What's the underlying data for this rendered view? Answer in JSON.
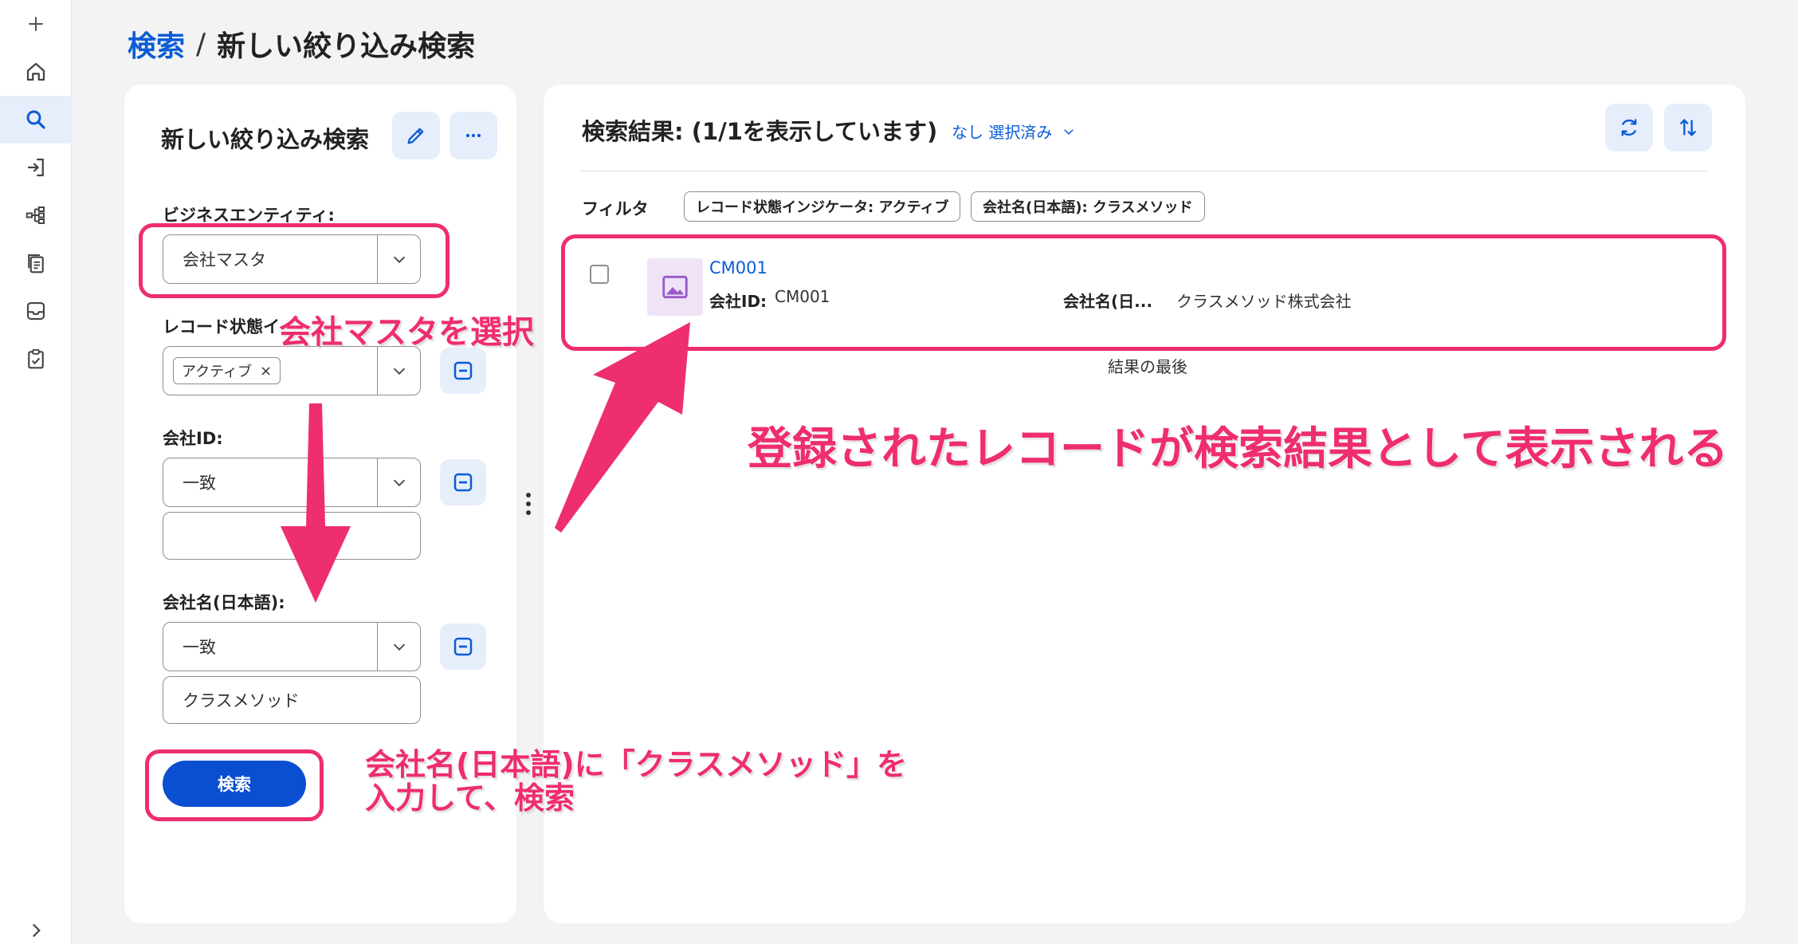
{
  "breadcrumb": {
    "root": "検索",
    "separator": "/",
    "current": "新しい絞り込み検索"
  },
  "rail": {
    "items": [
      "plus-icon",
      "home-icon",
      "search-icon",
      "login-icon",
      "hierarchy-icon",
      "documents-icon",
      "inbox-icon",
      "clipboard-check-icon"
    ],
    "active": "search-icon",
    "footer_icon": "chevron-right-icon"
  },
  "left_panel": {
    "title": "新しい絞り込み検索",
    "business_entity": {
      "label": "ビジネスエンティティ:",
      "value": "会社マスタ"
    },
    "record_status": {
      "label": "レコード状態インジケータ:",
      "chip": "アクティブ",
      "chip_remove": "×"
    },
    "company_id": {
      "label": "会社ID:",
      "operator": "一致",
      "value": ""
    },
    "company_name": {
      "label": "会社名(日本語):",
      "operator": "一致",
      "value": "クラスメソッド"
    },
    "search_button": "検索"
  },
  "right_panel": {
    "title": "検索結果: (1/1を表示しています)",
    "selected_label": "なし 選択済み",
    "filter_label": "フィルタ",
    "filters": [
      "レコード状態インジケータ: アクティブ",
      "会社名(日本語): クラスメソッド"
    ],
    "result": {
      "link": "CM001",
      "id_label": "会社ID:",
      "id_value": "CM001",
      "name_label": "会社名(日...",
      "name_value": "クラスメソッド株式会社"
    },
    "results_end": "結果の最後"
  },
  "annotations": {
    "select_entity": "会社マスタを選択",
    "result_shown": "登録されたレコードが検索結果として表示される",
    "enter_name_line1": "会社名(日本語)に「クラスメソッド」を",
    "enter_name_line2": "入力して、検索"
  },
  "colors": {
    "accent": "#0b4fd1",
    "link": "#0b5cd5",
    "annotation": "#ee2e6e",
    "icon_bg": "#e6eefb",
    "thumb_bg": "#efe3f7"
  }
}
